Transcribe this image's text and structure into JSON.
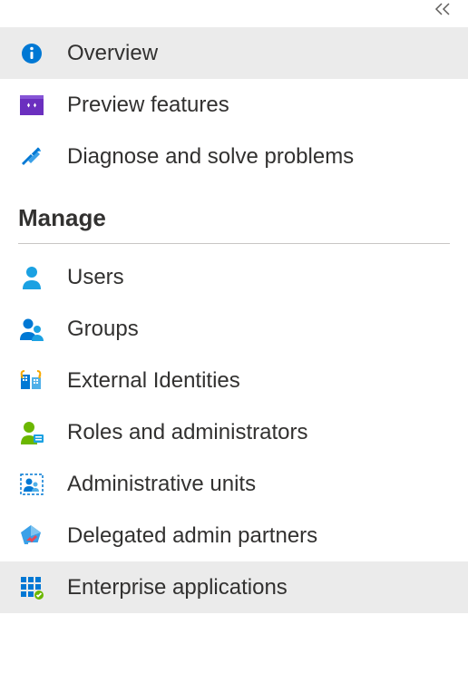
{
  "nav": {
    "topItems": [
      {
        "id": "overview",
        "label": "Overview",
        "icon": "info-icon",
        "selected": true
      },
      {
        "id": "preview-features",
        "label": "Preview features",
        "icon": "sparkle-icon",
        "selected": false
      },
      {
        "id": "diagnose",
        "label": "Diagnose and solve problems",
        "icon": "tools-icon",
        "selected": false
      }
    ],
    "sections": [
      {
        "title": "Manage",
        "items": [
          {
            "id": "users",
            "label": "Users",
            "icon": "user-icon",
            "selected": false
          },
          {
            "id": "groups",
            "label": "Groups",
            "icon": "groups-icon",
            "selected": false
          },
          {
            "id": "external-identities",
            "label": "External Identities",
            "icon": "external-icon",
            "selected": false
          },
          {
            "id": "roles",
            "label": "Roles and administrators",
            "icon": "roles-icon",
            "selected": false
          },
          {
            "id": "admin-units",
            "label": "Administrative units",
            "icon": "admin-units-icon",
            "selected": false
          },
          {
            "id": "delegated",
            "label": "Delegated admin partners",
            "icon": "delegated-icon",
            "selected": false
          },
          {
            "id": "enterprise-apps",
            "label": "Enterprise applications",
            "icon": "apps-icon",
            "selected": true
          }
        ]
      }
    ]
  }
}
